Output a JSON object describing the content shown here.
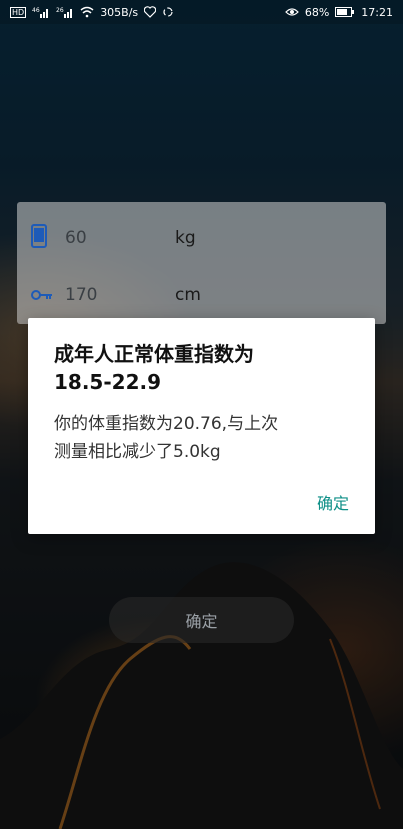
{
  "status_bar": {
    "left": {
      "net_label": "HD",
      "signal1": "46",
      "signal2": "26",
      "speed": "305B/s"
    },
    "right": {
      "battery": "68%",
      "time": "17:21"
    }
  },
  "form": {
    "weight": {
      "value": "60",
      "unit": "kg",
      "icon": "phone-icon"
    },
    "height": {
      "value": "170",
      "unit": "cm",
      "icon": "key-icon"
    }
  },
  "main_button": {
    "label": "确定"
  },
  "dialog": {
    "title_line1": "成年人正常体重指数为",
    "title_line2": "18.5-22.9",
    "message_line1": "你的体重指数为20.76,与上次",
    "message_line2": "测量相比减少了5.0kg",
    "ok_label": "确定"
  },
  "colors": {
    "accent": "#0d8f87",
    "icon_blue": "#1e5bb8"
  }
}
